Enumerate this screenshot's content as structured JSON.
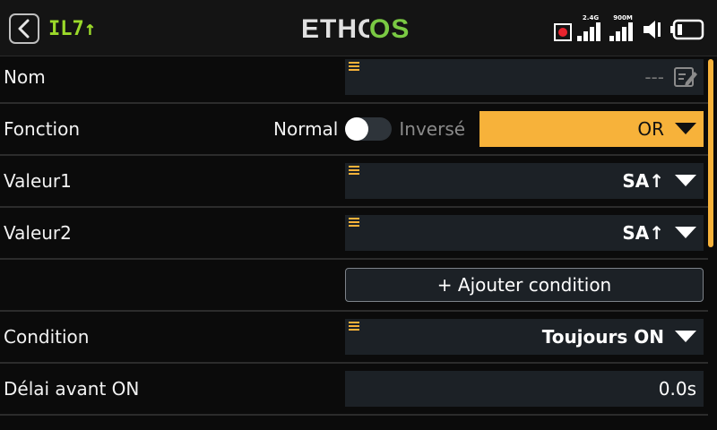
{
  "header": {
    "model_name": "IL7↑",
    "logo_text": "ETHOS",
    "radio_24_label": "2.4G",
    "radio_900_label": "900M",
    "icons": [
      "back-icon",
      "record-icon",
      "signal-icon",
      "volume-icon",
      "battery-icon"
    ]
  },
  "rows": {
    "nom": {
      "label": "Nom",
      "value": "---"
    },
    "fonction": {
      "label": "Fonction",
      "normal_label": "Normal",
      "inverse_label": "Inversé",
      "value": "OR"
    },
    "valeur1": {
      "label": "Valeur1",
      "value": "SA↑"
    },
    "valeur2": {
      "label": "Valeur2",
      "value": "SA↑"
    },
    "add": {
      "label": "+ Ajouter condition"
    },
    "condition": {
      "label": "Condition",
      "value": "Toujours ON"
    },
    "delai": {
      "label": "Délai avant ON",
      "value": "0.0s"
    }
  },
  "colors": {
    "accent": "#f7b23a",
    "model_green": "#9bd92a",
    "field_bg": "#1c2126",
    "background": "#0b0b0b"
  }
}
